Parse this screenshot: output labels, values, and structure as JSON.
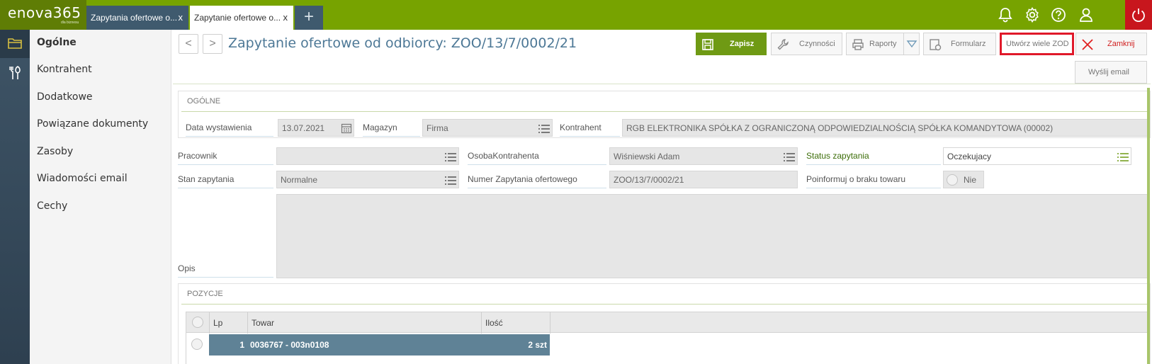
{
  "app": {
    "brand": "enova365",
    "tagline": "dla biznesu"
  },
  "tabs": [
    {
      "label": "Zapytania ofertowe o...",
      "close": "x"
    },
    {
      "label": "Zapytanie ofertowe o...",
      "close": "x"
    }
  ],
  "nav": {
    "items": [
      {
        "label": "Ogólne"
      },
      {
        "label": "Kontrahent"
      },
      {
        "label": "Dodatkowe"
      },
      {
        "label": "Powiązane dokumenty"
      },
      {
        "label": "Zasoby"
      },
      {
        "label": "Wiadomości email"
      },
      {
        "label": "Cechy"
      }
    ]
  },
  "header": {
    "title": "Zapytanie ofertowe od odbiorcy: ZOO/13/7/0002/21",
    "back": "<",
    "forward": ">"
  },
  "toolbar": {
    "save": "Zapisz",
    "actions": "Czynności",
    "reports": "Raporty",
    "form": "Formularz",
    "create_many": "Utwórz wiele ZOD",
    "close": "Zamknij",
    "send_email": "Wyślij email"
  },
  "general": {
    "section_title": "OGÓLNE",
    "date_label": "Data wystawienia",
    "date_value": "13.07.2021",
    "warehouse_label": "Magazyn",
    "warehouse_value": "Firma",
    "contractor_label": "Kontrahent",
    "contractor_value": "RGB ELEKTRONIKA SPÓŁKA Z OGRANICZONĄ ODPOWIEDZIALNOŚCIĄ SPÓŁKA KOMANDYTOWA (00002)",
    "employee_label": "Pracownik",
    "employee_value": "",
    "contact_label": "OsobaKontrahenta",
    "contact_value": "Wiśniewski Adam",
    "status_label": "Status zapytania",
    "status_value": "Oczekujacy",
    "state_label": "Stan zapytania",
    "state_value": "Normalne",
    "number_label": "Numer Zapytania ofertowego",
    "number_value": "ZOO/13/7/0002/21",
    "notify_label": "Poinformuj o braku towaru",
    "notify_value": "Nie",
    "description_label": "Opis",
    "description_value": ""
  },
  "positions": {
    "section_title": "POZYCJE",
    "columns": {
      "lp": "Lp",
      "item": "Towar",
      "qty": "Ilość"
    },
    "rows": [
      {
        "lp": "1",
        "item": "0036767 - 003n0108",
        "qty": "2 szt"
      }
    ]
  },
  "colors": {
    "topbar": "#77a300",
    "accent_red": "#c8161d",
    "title_blue": "#4d7896",
    "row_selected": "#5f8296"
  },
  "icons": [
    "bell-icon",
    "gear-icon",
    "help-icon",
    "user-icon",
    "power-icon",
    "folder-icon",
    "tools-icon",
    "save-icon",
    "wrench-icon",
    "printer-icon",
    "form-icon",
    "close-x-icon",
    "calendar-icon",
    "list-icon"
  ]
}
